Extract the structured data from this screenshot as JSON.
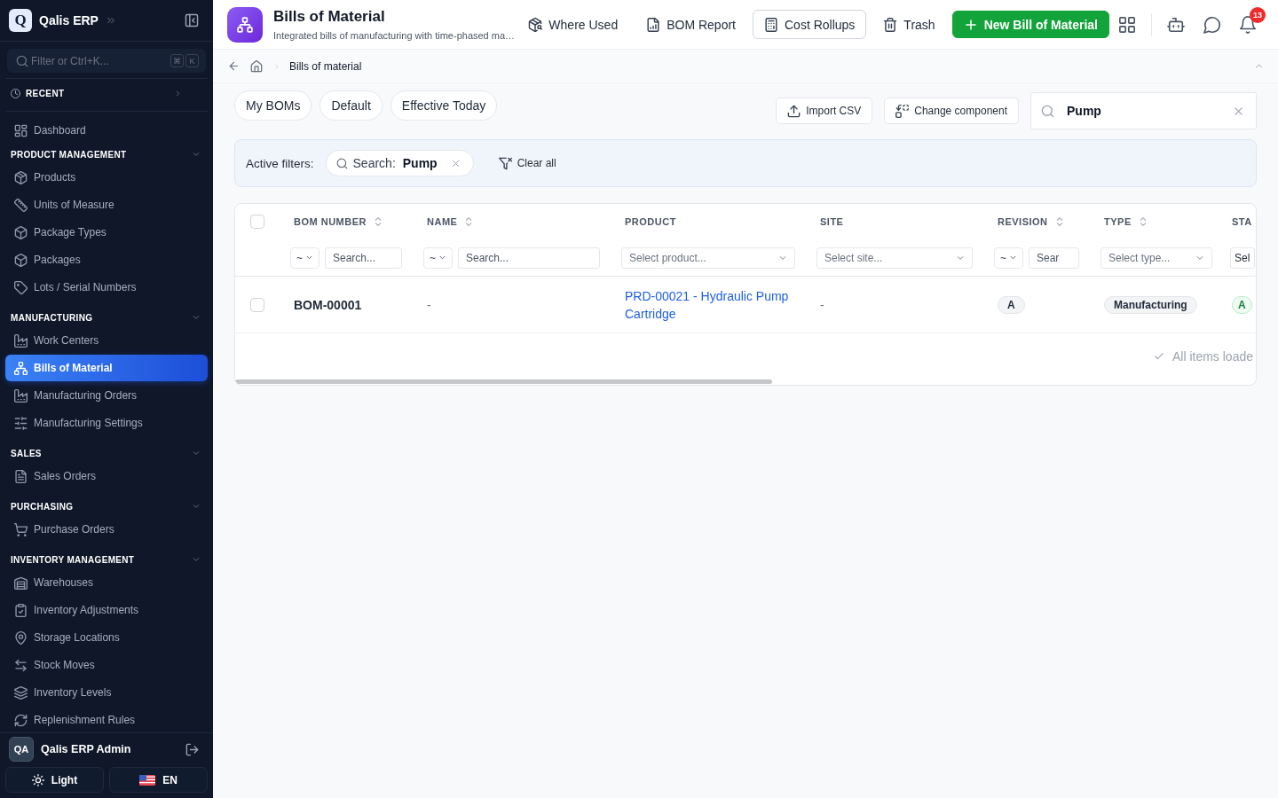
{
  "sidebar": {
    "brand": {
      "logo": "Q",
      "name": "Qalis ERP"
    },
    "filter": {
      "placeholder": "Filter or Ctrl+K...",
      "keys": [
        "⌘",
        "K"
      ]
    },
    "recent": {
      "label": "RECENT",
      "expanded": false
    },
    "items": [
      {
        "label": "Dashboard",
        "selected": false
      }
    ],
    "sections": [
      {
        "title": "PRODUCT MANAGEMENT",
        "expanded": true,
        "items": [
          {
            "label": "Products",
            "selected": false
          },
          {
            "label": "Units of Measure",
            "selected": false
          },
          {
            "label": "Package Types",
            "selected": false
          },
          {
            "label": "Packages",
            "selected": false
          },
          {
            "label": "Lots / Serial Numbers",
            "selected": false
          }
        ]
      },
      {
        "title": "MANUFACTURING",
        "expanded": true,
        "items": [
          {
            "label": "Work Centers",
            "selected": false
          },
          {
            "label": "Bills of Material",
            "selected": true
          },
          {
            "label": "Manufacturing Orders",
            "selected": false
          },
          {
            "label": "Manufacturing Settings",
            "selected": false
          }
        ]
      },
      {
        "title": "SALES",
        "expanded": true,
        "items": [
          {
            "label": "Sales Orders",
            "selected": false
          }
        ]
      },
      {
        "title": "PURCHASING",
        "expanded": true,
        "items": [
          {
            "label": "Purchase Orders",
            "selected": false
          }
        ]
      },
      {
        "title": "INVENTORY MANAGEMENT",
        "expanded": true,
        "items": [
          {
            "label": "Warehouses",
            "selected": false
          },
          {
            "label": "Inventory Adjustments",
            "selected": false
          },
          {
            "label": "Storage Locations",
            "selected": false
          },
          {
            "label": "Stock Moves",
            "selected": false
          },
          {
            "label": "Inventory Levels",
            "selected": false
          },
          {
            "label": "Replenishment Rules",
            "selected": false
          }
        ]
      }
    ],
    "user": {
      "initials": "QA",
      "name": "Qalis ERP Admin"
    },
    "theme_button": "Light",
    "language_button": "EN"
  },
  "header": {
    "title": "Bills of Material",
    "subtitle": "Integrated bills of manufacturing with time-phased ma…",
    "actions": [
      {
        "kind": "ghost",
        "label": "Where Used"
      },
      {
        "kind": "ghost",
        "label": "BOM Report"
      },
      {
        "kind": "outline",
        "label": "Cost Rollups"
      },
      {
        "kind": "ghost",
        "label": "Trash"
      },
      {
        "kind": "primary",
        "label": "New Bill of Material"
      }
    ],
    "notifications": "13"
  },
  "breadcrumb": {
    "current": "Bills of material"
  },
  "views": [
    "My BOMs",
    "Default",
    "Effective Today"
  ],
  "toolbar": {
    "buttons": [
      "Import CSV",
      "Change component"
    ],
    "search": {
      "value": "Pump"
    }
  },
  "active_filters": {
    "label": "Active filters:",
    "chips": [
      {
        "label": "Search:",
        "value": "Pump"
      }
    ],
    "clear": "Clear all"
  },
  "table": {
    "all_selected": false,
    "columns": [
      {
        "label": "BOM NUMBER",
        "sortable": true,
        "filter": {
          "kind": "operator_text",
          "operator": "~",
          "placeholder": "Search..."
        }
      },
      {
        "label": "NAME",
        "sortable": true,
        "filter": {
          "kind": "operator_text",
          "operator": "~",
          "placeholder": "Search..."
        }
      },
      {
        "label": "PRODUCT",
        "sortable": false,
        "filter": {
          "kind": "select",
          "placeholder": "Select product..."
        }
      },
      {
        "label": "SITE",
        "sortable": false,
        "filter": {
          "kind": "select",
          "placeholder": "Select site..."
        }
      },
      {
        "label": "REVISION",
        "sortable": true,
        "filter": {
          "kind": "operator_text",
          "operator": "~",
          "placeholder": "Sear"
        }
      },
      {
        "label": "TYPE",
        "sortable": true,
        "filter": {
          "kind": "select",
          "placeholder": "Select type..."
        }
      },
      {
        "label": "STA",
        "sortable": false,
        "clipped": true,
        "filter": {
          "kind": "select",
          "placeholder": "Sel"
        }
      }
    ],
    "rows": [
      {
        "selected": false,
        "cells": [
          {
            "kind": "text",
            "text": "BOM-00001"
          },
          {
            "kind": "muted",
            "text": "-"
          },
          {
            "kind": "link",
            "text": "PRD-00021 - Hydraulic Pump Cartridge"
          },
          {
            "kind": "muted",
            "text": "-"
          },
          {
            "kind": "badge",
            "text": "A"
          },
          {
            "kind": "badge",
            "text": "Manufacturing"
          },
          {
            "kind": "status",
            "text": "A"
          }
        ]
      }
    ],
    "footer": "All items loade"
  }
}
